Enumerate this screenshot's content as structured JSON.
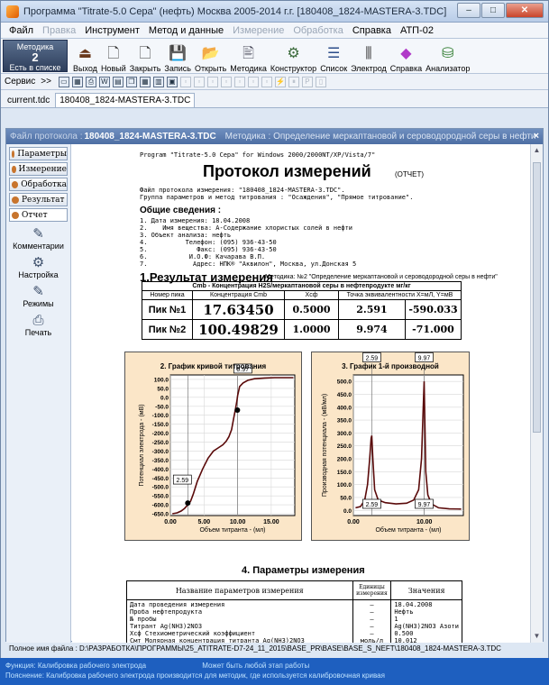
{
  "window": {
    "title": "Программа \"Titrate-5.0 Сера\" (нефть) Москва 2005-2014 г.г. [180408_1824-MASTERA-3.TDC]",
    "controls": [
      "–",
      "□",
      "✕"
    ]
  },
  "menu": [
    {
      "label": "Файл",
      "disabled": false
    },
    {
      "label": "Правка",
      "disabled": true
    },
    {
      "label": "Инструмент",
      "disabled": false
    },
    {
      "label": "Метод и данные",
      "disabled": false
    },
    {
      "label": "Измерение",
      "disabled": true
    },
    {
      "label": "Обработка",
      "disabled": true
    },
    {
      "label": "Справка",
      "disabled": false
    },
    {
      "label": "АТП-02",
      "disabled": false
    }
  ],
  "toolbar": {
    "method_box": {
      "line1": "Методика",
      "num": "2",
      "line3": "Есть в списке"
    },
    "buttons": [
      {
        "label": "Выход",
        "icon": "exit-icon",
        "glyph": "⏏",
        "color": "#6b3a1c"
      },
      {
        "label": "Новый",
        "icon": "new-doc-icon",
        "glyph": "🗋",
        "color": "#333"
      },
      {
        "label": "Закрыть",
        "icon": "close-doc-icon",
        "glyph": "🗋",
        "color": "#333"
      },
      {
        "label": "Запись",
        "icon": "save-icon",
        "glyph": "💾",
        "color": "#c98a00"
      },
      {
        "label": "Открыть",
        "icon": "open-folder-icon",
        "glyph": "📂",
        "color": "#d9a400"
      },
      {
        "label": "Методика",
        "icon": "method-icon",
        "glyph": "🖹",
        "color": "#445"
      },
      {
        "label": "Конструктор",
        "icon": "constructor-icon",
        "glyph": "⚙",
        "color": "#3a6a3a"
      },
      {
        "label": "Список",
        "icon": "list-icon",
        "glyph": "☰",
        "color": "#2b4c8a"
      },
      {
        "label": "Электрод",
        "icon": "electrode-icon",
        "glyph": "⫼",
        "color": "#333"
      },
      {
        "label": "Справка",
        "icon": "help-book-icon",
        "glyph": "◆",
        "color": "#b03ac8"
      },
      {
        "label": "Анализатор",
        "icon": "analyzer-icon",
        "glyph": "⛁",
        "color": "#2c7a2c"
      }
    ]
  },
  "toolbar2": {
    "label": "Сервис",
    "arrows": ">>",
    "icons": [
      {
        "name": "print-preview-icon",
        "glyph": "▭",
        "dim": false
      },
      {
        "name": "page-setup-icon",
        "glyph": "▦",
        "dim": false
      },
      {
        "name": "print-icon",
        "glyph": "⎙",
        "dim": false
      },
      {
        "name": "word-export-icon",
        "glyph": "W",
        "dim": false
      },
      {
        "name": "table-icon",
        "glyph": "▤",
        "dim": false
      },
      {
        "name": "copy-icon",
        "glyph": "❐",
        "dim": false
      },
      {
        "name": "grid-icon",
        "glyph": "▦",
        "dim": false
      },
      {
        "name": "chart-icon",
        "glyph": "▥",
        "dim": false
      },
      {
        "name": "save-small-icon",
        "glyph": "▣",
        "dim": false
      },
      {
        "name": "tool-dim-1-icon",
        "glyph": "▫",
        "dim": true
      },
      {
        "name": "tool-dim-2-icon",
        "glyph": "▫",
        "dim": true
      },
      {
        "name": "tool-dim-3-icon",
        "glyph": "▫",
        "dim": true
      },
      {
        "name": "tool-dim-4-icon",
        "glyph": "▫",
        "dim": true
      },
      {
        "name": "tool-dim-5-icon",
        "glyph": "▫",
        "dim": true
      },
      {
        "name": "tool-dim-6-icon",
        "glyph": "▫",
        "dim": true
      },
      {
        "name": "tool-dim-7-icon",
        "glyph": "▫",
        "dim": true
      },
      {
        "name": "tool-dim-8-icon",
        "glyph": "⚡",
        "dim": true
      },
      {
        "name": "tool-dim-9-icon",
        "glyph": "⏸",
        "dim": true
      },
      {
        "name": "tool-dim-10-icon",
        "glyph": "P",
        "dim": true
      },
      {
        "name": "tool-dim-11-icon",
        "glyph": "▯",
        "dim": true
      }
    ]
  },
  "tabs": [
    {
      "label": "current.tdc",
      "active": false
    },
    {
      "label": "180408_1824-MASTERA-3.TDC",
      "active": true
    }
  ],
  "doc": {
    "prefix": "Файл протокола :",
    "filename": "180408_1824-MASTERA-3.TDC",
    "method": "Методика : Определение меркаптановой и сероводородной серы в нефти",
    "close": "×"
  },
  "sidebar": {
    "tabs": [
      {
        "label": "Параметры",
        "active": false
      },
      {
        "label": "Измерение",
        "active": false
      },
      {
        "label": "Обработка",
        "active": false
      },
      {
        "label": "Результат",
        "active": false
      },
      {
        "label": "Отчет",
        "active": true
      }
    ],
    "actions": [
      {
        "label": "Комментарии",
        "icon": "comments-icon",
        "glyph": "✎"
      },
      {
        "label": "Настройка",
        "icon": "settings-icon",
        "glyph": "⚙"
      },
      {
        "label": "Режимы",
        "icon": "modes-icon",
        "glyph": "✎"
      },
      {
        "label": "Печать",
        "icon": "print-icon",
        "glyph": "⎙"
      }
    ]
  },
  "report": {
    "program": "Program \"Titrate-5.0 Сера\" for Windows 2000/2000NT/XP/Vista/7\"",
    "title": "Протокол измерений",
    "subtitle": "(ОТЧЕТ)",
    "info_lines": [
      "Файл протокола измерения: \"180408_1824-MASTERA-3.TDC\".",
      "Группа параметров и метод титрования : \"Осаждения\", \"Прямое титрование\"."
    ],
    "general_title": "Общие сведения :",
    "general_lines": [
      "1. Дата измерения: 18.04.2008",
      "2.    Имя вещества: А-Содержание хлористых солей в нефти",
      "3. Объект анализа: нефть",
      "4.          Телефон: (095) 936-43-50",
      "5.             Факс: (095) 936-43-50",
      "6.           И.О.Ф: Качарава В.П.",
      "7.            Адрес: НПК® \"Аквилон\", Москва, ул.Донская 5"
    ],
    "result_title": "1.Результат измерения",
    "result_method": "Методика: №2 \"Определение меркаптановой и сероводородной серы в нефти\"",
    "table_caption": "Cmb - Концентрация H2S/меркаптановой серы в нефтепродукте мг/кг",
    "table_headers": [
      "Номер пика",
      "Концентрация Cmb",
      "Хсф",
      "Точка эквивалентности X=мЛ, Y=мВ"
    ],
    "rows": [
      [
        "Пик №1",
        "17.63450",
        "0.5000",
        "2.591",
        "-590.033"
      ],
      [
        "Пик №2",
        "100.49829",
        "1.0000",
        "9.974",
        "-71.000"
      ]
    ],
    "params_title": "4. Параметры измерения",
    "params_headers": [
      "Название параметров измерения",
      "Единицы измерения",
      "Значения"
    ],
    "params_rows": [
      [
        "Дата проведения измерения",
        "–",
        "18.04.2008"
      ],
      [
        "Проба нефтепродукта",
        "–",
        "Нефть"
      ],
      [
        "№ пробы",
        "–",
        "1"
      ],
      [
        "Титрант Ag(NH3)2NO3",
        "–",
        "Ag(NH3)2NO3 Азоти"
      ],
      [
        "Хсф Стехиометрический коэффициент",
        "–",
        "0.500"
      ],
      [
        "Cмт Молярная концентрация титранта Ag(NH3)2NO3",
        "моль/л",
        "10.012"
      ]
    ]
  },
  "chart_data": [
    {
      "type": "line",
      "title": "2. График кривой титрования",
      "xlabel": "Объем титранта - (мл)",
      "ylabel": "Потенциал электрода - (мВ)",
      "xlim": [
        0,
        18.5
      ],
      "ylim": [
        -660,
        125
      ],
      "xticks": [
        "0.00",
        "5.00",
        "10.00",
        "15.00"
      ],
      "yticks": [
        "100.0",
        "50.0",
        "0.0",
        "-50.0",
        "-100.0",
        "-150.0",
        "-200.0",
        "-250.0",
        "-300.0",
        "-350.0",
        "-400.0",
        "-450.0",
        "-500.0",
        "-550.0",
        "-600.0",
        "-650.0"
      ],
      "x": [
        0.3,
        1.0,
        1.6,
        2.1,
        2.6,
        3.0,
        3.4,
        4.0,
        4.8,
        5.6,
        6.4,
        7.2,
        7.8,
        8.3,
        8.7,
        9.1,
        9.4,
        9.7,
        9.9,
        10.0,
        10.3,
        10.8,
        11.5,
        12.5,
        14.0,
        15.5,
        17.0,
        18.3
      ],
      "y": [
        -650,
        -645,
        -635,
        -620,
        -600,
        -580,
        -540,
        -470,
        -400,
        -340,
        -300,
        -280,
        -265,
        -245,
        -220,
        -180,
        -120,
        -60,
        -20,
        10,
        60,
        80,
        95,
        104,
        108,
        110,
        110,
        110
      ],
      "markers": [
        {
          "x": 2.59,
          "y": -590,
          "label": "2.59"
        },
        {
          "x": 9.97,
          "y": -71,
          "label": "9.97"
        }
      ],
      "grid": true
    },
    {
      "type": "line",
      "title": "3. График 1-й производной",
      "xlabel": "Объем титранта - (мл)",
      "ylabel": "Производная потенциала - (мВ/мл)",
      "xlim": [
        0,
        15.5
      ],
      "ylim": [
        -20,
        525
      ],
      "xticks": [
        "0.00",
        "10.00"
      ],
      "yticks": [
        "500.0",
        "450.0",
        "400.0",
        "350.0",
        "300.0",
        "250.0",
        "200.0",
        "150.0",
        "100.0",
        "50.0",
        "0.0"
      ],
      "x": [
        0.3,
        1.0,
        1.6,
        2.0,
        2.3,
        2.5,
        2.59,
        2.75,
        3.0,
        3.5,
        4.5,
        6.0,
        7.5,
        8.5,
        9.2,
        9.6,
        9.85,
        9.97,
        10.05,
        10.2,
        10.5,
        11.0,
        12.0,
        13.5,
        15.2
      ],
      "y": [
        10,
        15,
        40,
        100,
        200,
        280,
        290,
        200,
        80,
        40,
        30,
        25,
        28,
        40,
        80,
        200,
        400,
        500,
        380,
        150,
        60,
        25,
        10,
        6,
        5
      ],
      "markers": [
        {
          "x": 2.59,
          "label": "2.59"
        },
        {
          "x": 9.97,
          "label": "9.97"
        }
      ],
      "grid": true
    }
  ],
  "pathbar": "Полное имя файла : D:\\РАЗРАБОТКА\\ПРОГРАММЫ\\25_ATITRATE-D7-24_11_2015\\BASE_PR\\BASE\\BASE_S_NEFT\\180408_1824-MASTERA-3.TDC",
  "status": {
    "line1_a": "Функция: Калибровка рабочего электрода",
    "line1_b": "Может быть любой этап работы",
    "line2": "Пояснение: Калибровка рабочего электрода производится для методик, где используется калибровочная кривая"
  },
  "colors": {
    "graph_bg": "#fbe6c8",
    "curve": "#5a0a0a",
    "status_bg": "#1e5fbf"
  }
}
